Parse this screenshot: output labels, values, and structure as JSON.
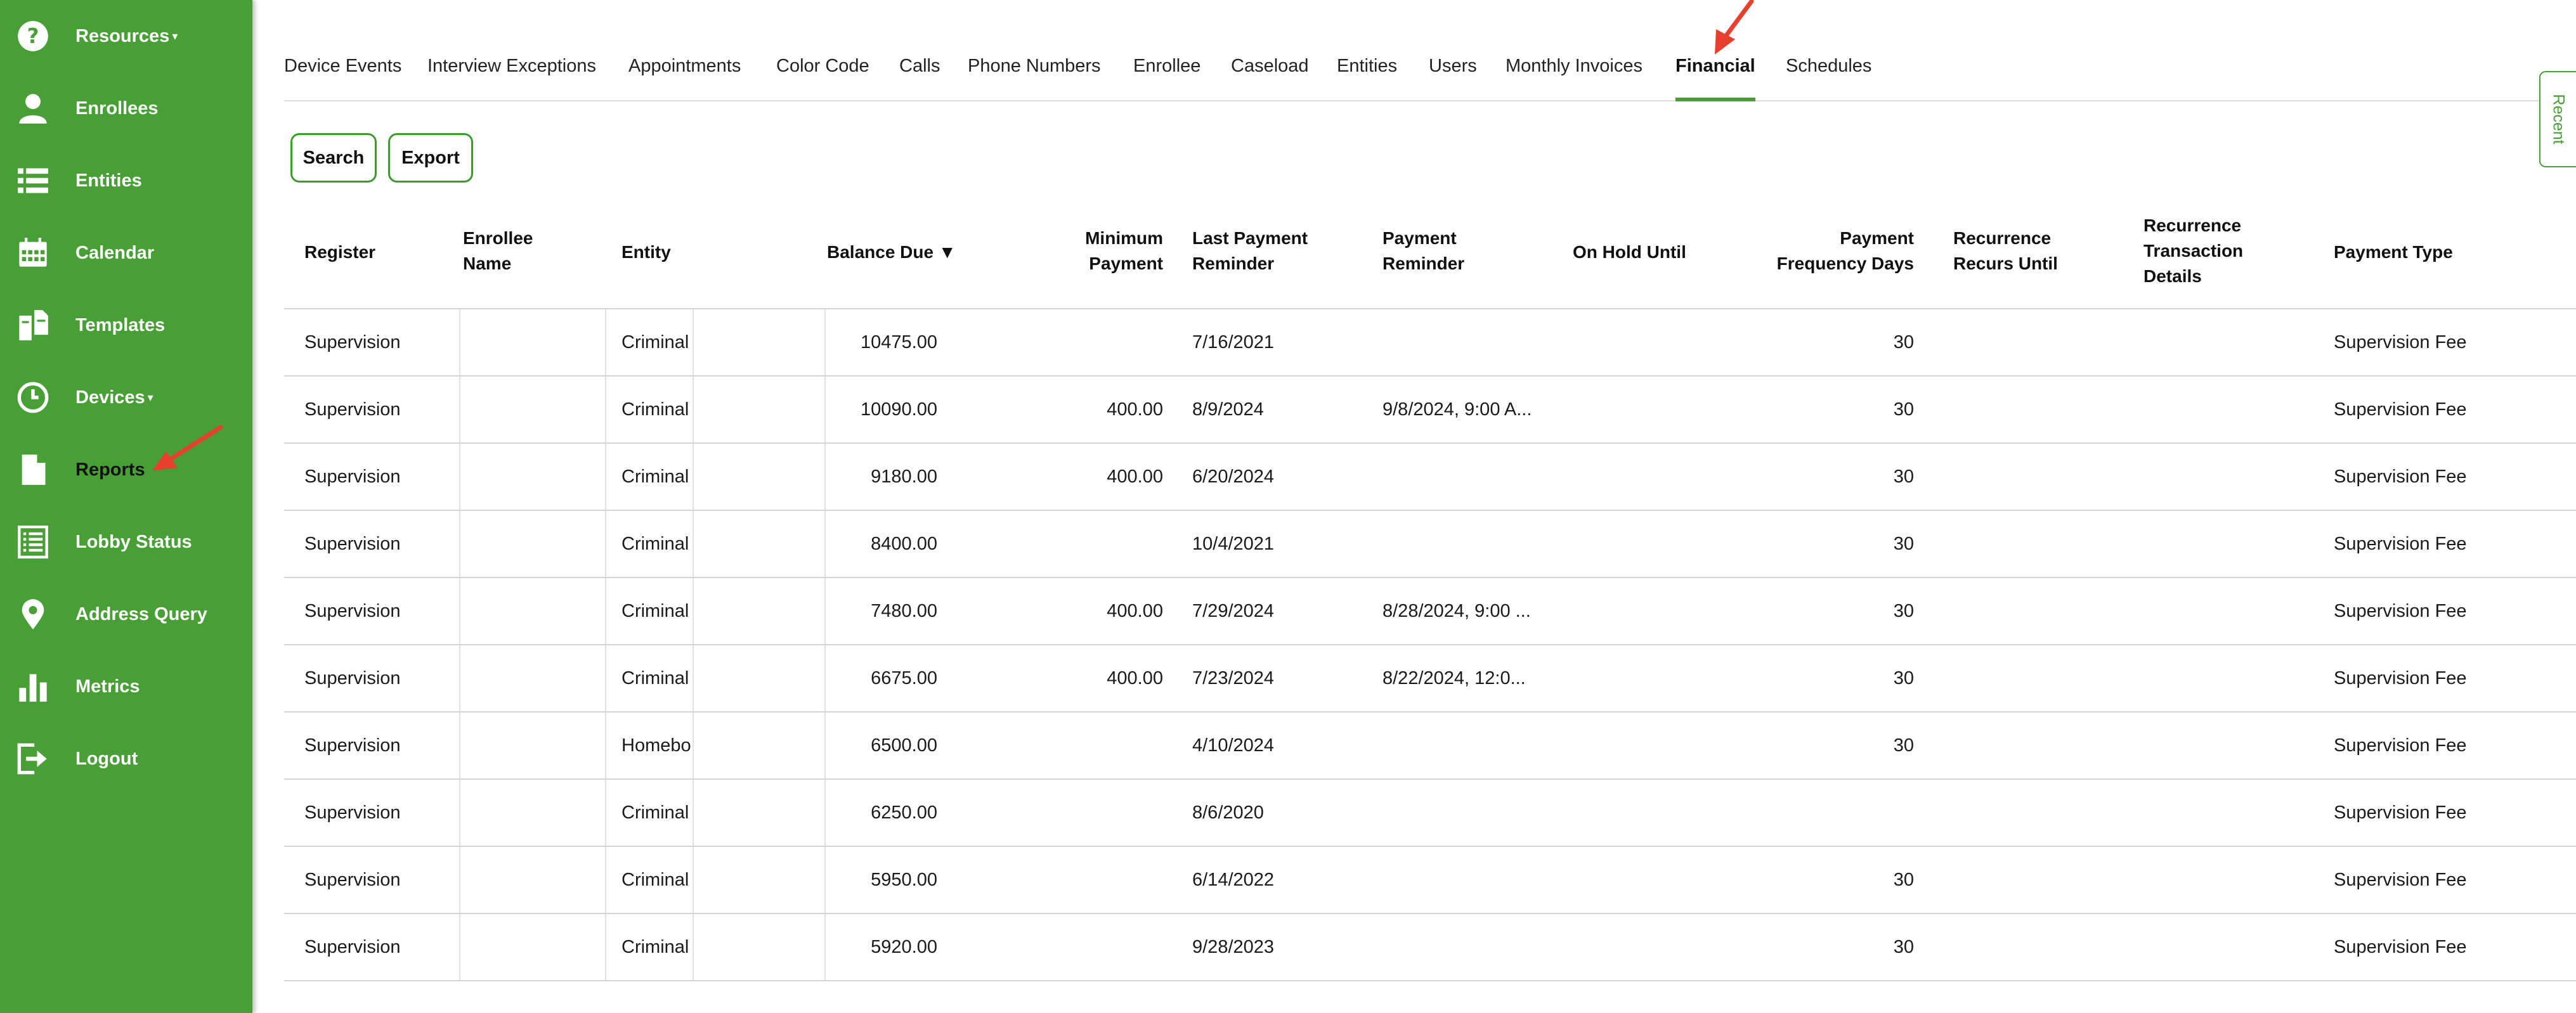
{
  "sidebar": {
    "items": [
      {
        "label": "Resources",
        "has_caret": true,
        "icon": "help-circle-icon"
      },
      {
        "label": "Enrollees",
        "has_caret": false,
        "icon": "person-icon"
      },
      {
        "label": "Entities",
        "has_caret": false,
        "icon": "list-icon"
      },
      {
        "label": "Calendar",
        "has_caret": false,
        "icon": "calendar-icon"
      },
      {
        "label": "Templates",
        "has_caret": false,
        "icon": "documents-icon"
      },
      {
        "label": "Devices",
        "has_caret": true,
        "icon": "clock-icon"
      },
      {
        "label": "Reports",
        "has_caret": false,
        "icon": "file-icon"
      },
      {
        "label": "Lobby Status",
        "has_caret": false,
        "icon": "checklist-icon"
      },
      {
        "label": "Address Query",
        "has_caret": false,
        "icon": "map-pin-icon"
      },
      {
        "label": "Metrics",
        "has_caret": false,
        "icon": "bar-chart-icon"
      },
      {
        "label": "Logout",
        "has_caret": false,
        "icon": "logout-icon"
      }
    ],
    "caret": "▾"
  },
  "tabs": [
    "Device Events",
    "Interview Exceptions",
    "Appointments",
    "Color Code",
    "Calls",
    "Phone Numbers",
    "Enrollee",
    "Caseload",
    "Entities",
    "Users",
    "Monthly Invoices",
    "Financial",
    "Schedules"
  ],
  "active_tab": "Financial",
  "buttons": {
    "search": "Search",
    "export": "Export"
  },
  "recent_label": "Recent",
  "table": {
    "sort_indicator": "▼",
    "headers": [
      "Register",
      "Enrollee Name",
      "Entity",
      "Balance Due",
      "Minimum Payment",
      "Last Payment Reminder",
      "Payment Reminder",
      "On Hold Until",
      "Payment Frequency Days",
      "Recurrence Recurs Until",
      "Recurrence Transaction Details",
      "Payment Type"
    ],
    "rows": [
      [
        "Supervision",
        "",
        "Criminal",
        "10475.00",
        "",
        "7/16/2021",
        "",
        "",
        "30",
        "",
        "",
        "Supervision Fee"
      ],
      [
        "Supervision",
        "",
        "Criminal",
        "10090.00",
        "400.00",
        "8/9/2024",
        "9/8/2024, 9:00 A...",
        "",
        "30",
        "",
        "",
        "Supervision Fee"
      ],
      [
        "Supervision",
        "",
        "Criminal",
        "9180.00",
        "400.00",
        "6/20/2024",
        "",
        "",
        "30",
        "",
        "",
        "Supervision Fee"
      ],
      [
        "Supervision",
        "",
        "Criminal",
        "8400.00",
        "",
        "10/4/2021",
        "",
        "",
        "30",
        "",
        "",
        "Supervision Fee"
      ],
      [
        "Supervision",
        "",
        "Criminal",
        "7480.00",
        "400.00",
        "7/29/2024",
        "8/28/2024, 9:00 ...",
        "",
        "30",
        "",
        "",
        "Supervision Fee"
      ],
      [
        "Supervision",
        "",
        "Criminal",
        "6675.00",
        "400.00",
        "7/23/2024",
        "8/22/2024, 12:0...",
        "",
        "30",
        "",
        "",
        "Supervision Fee"
      ],
      [
        "Supervision",
        "",
        "Homebo",
        "6500.00",
        "",
        "4/10/2024",
        "",
        "",
        "30",
        "",
        "",
        "Supervision Fee"
      ],
      [
        "Supervision",
        "",
        "Criminal",
        "6250.00",
        "",
        "8/6/2020",
        "",
        "",
        "",
        "",
        "",
        "Supervision Fee"
      ],
      [
        "Supervision",
        "",
        "Criminal",
        "5950.00",
        "",
        "6/14/2022",
        "",
        "",
        "30",
        "",
        "",
        "Supervision Fee"
      ],
      [
        "Supervision",
        "",
        "Criminal",
        "5920.00",
        "",
        "9/28/2023",
        "",
        "",
        "30",
        "",
        "",
        "Supervision Fee"
      ]
    ]
  },
  "colors": {
    "brand_green": "#489f35",
    "annotation_red": "#e8402f"
  }
}
